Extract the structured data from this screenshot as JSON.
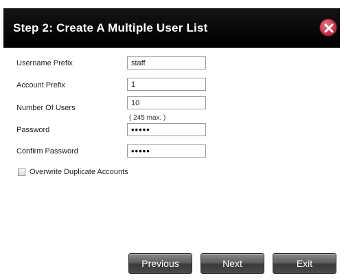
{
  "dialog": {
    "title": "Step 2: Create A Multiple User List",
    "close_icon": "close-icon"
  },
  "form": {
    "username_prefix_label": "Username Prefix",
    "username_prefix_value": "staff",
    "account_prefix_label": "Account Prefix",
    "account_prefix_value": "1",
    "number_of_users_label": "Number Of Users",
    "number_of_users_value": "10",
    "number_of_users_hint": "( 245 max. )",
    "password_label": "Password",
    "password_value": "•••••",
    "confirm_password_label": "Confirm Password",
    "confirm_password_value": "•••••",
    "overwrite_label": "Overwrite Duplicate Accounts",
    "overwrite_checked": false
  },
  "buttons": {
    "previous": "Previous",
    "next": "Next",
    "exit": "Exit"
  },
  "colors": {
    "titlebar": "#000000",
    "close": "#c23248",
    "button": "#4a4a4a"
  }
}
